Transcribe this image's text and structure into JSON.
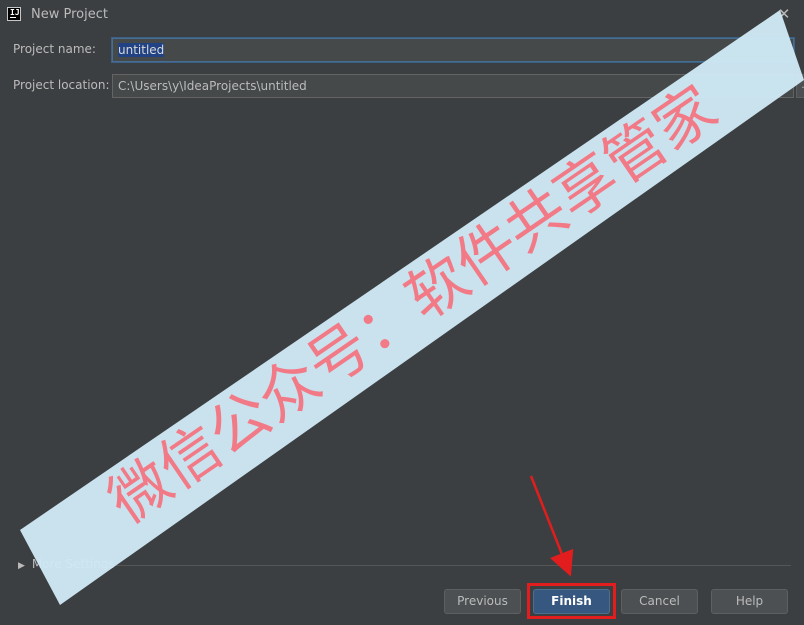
{
  "window": {
    "title": "New Project",
    "close_glyph": "✕",
    "app_icon": "intellij-idea-icon"
  },
  "form": {
    "name_label": "Project name:",
    "name_value": "untitled",
    "location_label": "Project location:",
    "location_value": "C:\\Users\\y\\IdeaProjects\\untitled",
    "browse_label": "..."
  },
  "more_settings": {
    "chevron": "▶",
    "label": "More Settings"
  },
  "buttons": {
    "previous": "Previous",
    "finish": "Finish",
    "cancel": "Cancel",
    "help": "Help"
  },
  "watermark": {
    "text": "微信公众号：软件共享管家",
    "band_color": "#cfe9f6",
    "text_color": "#f27a86"
  },
  "annotation": {
    "color": "#e21d1d"
  }
}
